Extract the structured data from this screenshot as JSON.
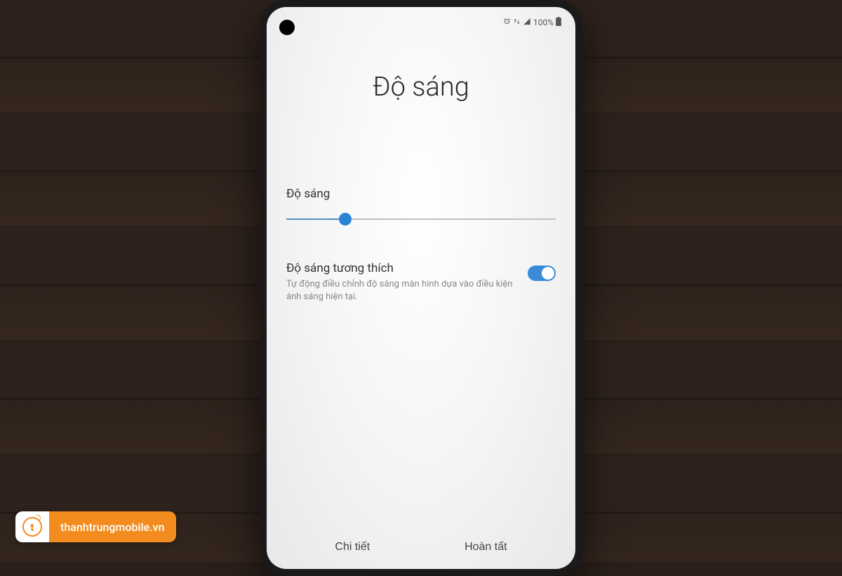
{
  "status_bar": {
    "battery_text": "100%",
    "icons": {
      "alarm": "⏰",
      "wifi": "📶",
      "signal": "📶",
      "battery": "🔋"
    }
  },
  "page": {
    "title": "Độ sáng"
  },
  "brightness": {
    "label": "Độ sáng",
    "value_percent": 22
  },
  "adaptive": {
    "title": "Độ sáng tương thích",
    "description": "Tự động điều chỉnh độ sáng màn hình dựa vào điều kiện ánh sáng hiện tại.",
    "enabled": true
  },
  "footer": {
    "detail": "Chi tiết",
    "done": "Hoàn tất"
  },
  "watermark": {
    "icon_letter": "t",
    "text": "thanhtrungmobile.vn"
  }
}
